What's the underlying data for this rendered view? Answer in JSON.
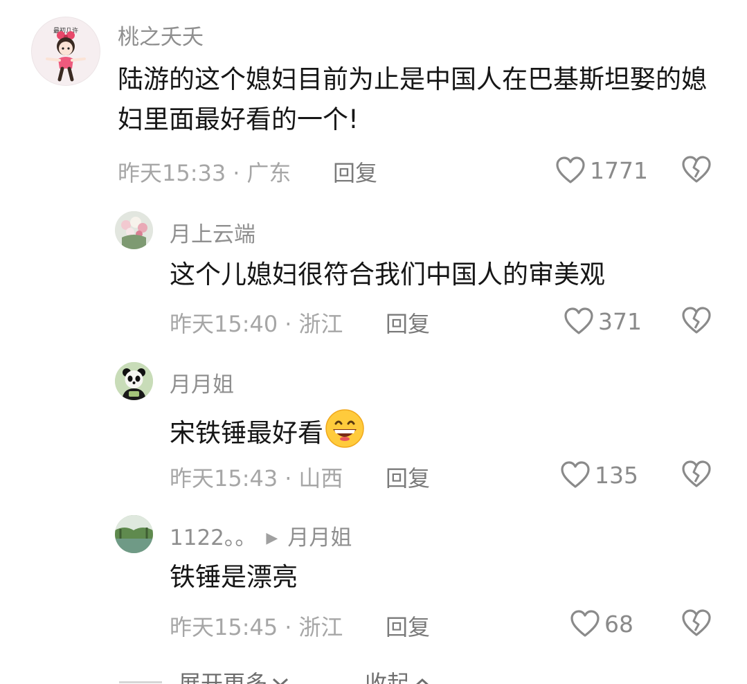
{
  "comments": [
    {
      "username": "桃之夭夭",
      "text": "陆游的这个媳妇目前为止是中国人在巴基斯坦娶的媳妇里面最好看的一个!",
      "time": "昨天15:33",
      "location": "广东",
      "reply_label": "回复",
      "likes": "1771",
      "avatar_text": "最初几许"
    },
    {
      "username": "月上云端",
      "text": "这个儿媳妇很符合我们中国人的审美观",
      "time": "昨天15:40",
      "location": "浙江",
      "reply_label": "回复",
      "likes": "371"
    },
    {
      "username": "月月姐",
      "text": "宋铁锤最好看",
      "time": "昨天15:43",
      "location": "山西",
      "reply_label": "回复",
      "likes": "135",
      "emoji": "grinning-face"
    },
    {
      "username": "1122。。",
      "reply_to": "月月姐",
      "text": "铁锤是漂亮",
      "time": "昨天15:45",
      "location": "浙江",
      "reply_label": "回复",
      "likes": "68"
    }
  ],
  "meta_separator": "·",
  "reply_arrow": "▶",
  "footer": {
    "expand_label": "展开更多",
    "collapse_label": "收起",
    "expand_icon": "chevron-down-icon",
    "collapse_icon": "chevron-up-icon"
  },
  "colors": {
    "username": "#8f8f8f",
    "text": "#161616",
    "meta": "#a6a6a6",
    "icon": "#8a8a8a"
  }
}
